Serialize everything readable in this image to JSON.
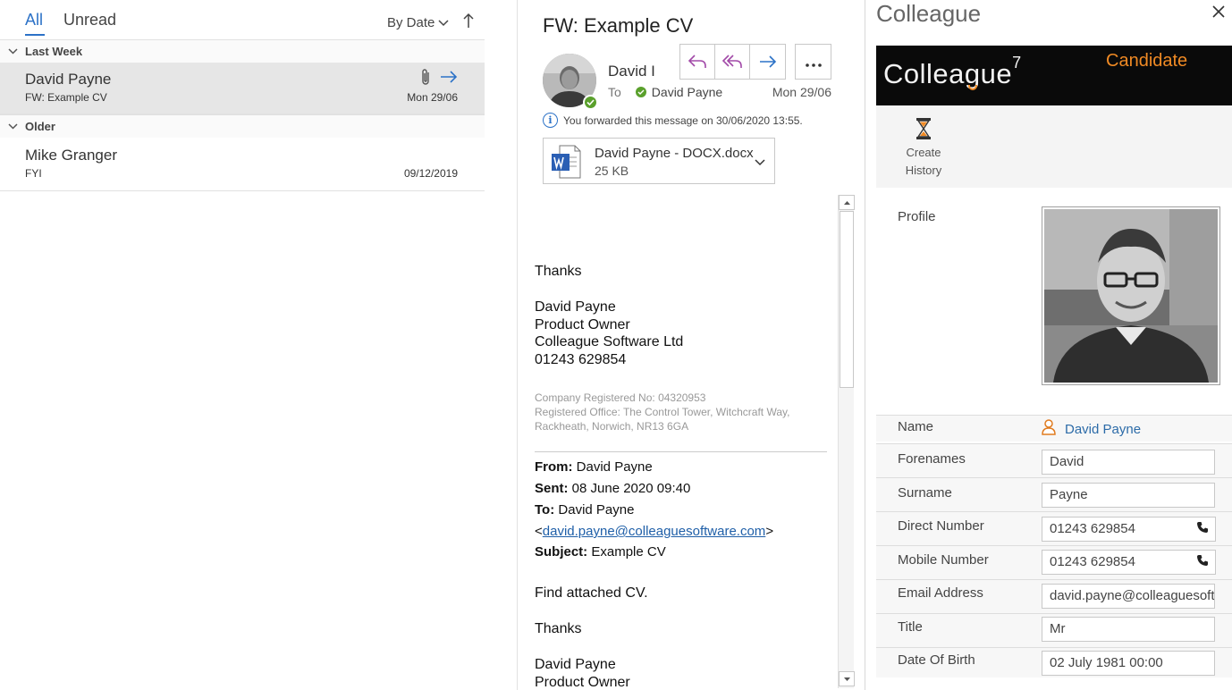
{
  "list": {
    "tabs": [
      {
        "label": "All"
      },
      {
        "label": "Unread"
      }
    ],
    "sort_label": "By Date",
    "groups": [
      {
        "label": "Last Week"
      },
      {
        "label": "Older"
      }
    ],
    "messages": [
      {
        "sender": "David Payne",
        "subject": "FW: Example CV",
        "date": "Mon 29/06"
      },
      {
        "sender": "Mike Granger",
        "subject": "FYI",
        "date": "09/12/2019"
      }
    ]
  },
  "reading": {
    "subject": "FW: Example CV",
    "sender": "David I",
    "to_label": "To",
    "recipient": "David Payne",
    "date": "Mon 29/06",
    "forward_note": "You forwarded this message on 30/06/2020 13:55.",
    "attachment": {
      "name": "David Payne - DOCX.docx",
      "size": "25 KB"
    },
    "body": {
      "thanks1": "Thanks",
      "sig_lines": [
        "David Payne",
        "Product Owner",
        "Colleague Software Ltd",
        "01243 629854"
      ],
      "disclaimer": [
        "Company Registered No: 04320953",
        "Registered Office: The Control Tower, Witchcraft Way,",
        "Rackheath, Norwich, NR13 6GA"
      ],
      "from_label": "From:",
      "from_value": "David Payne",
      "sent_label": "Sent:",
      "sent_value": "08 June 2020 09:40",
      "to_label": "To:",
      "to_value": "David Payne",
      "email_open": "<",
      "email_link": "david.payne@colleaguesoftware.com",
      "email_close": ">",
      "subject_label": "Subject:",
      "subject_value": "Example CV",
      "find_text": "Find attached CV.",
      "thanks2": "Thanks",
      "sig2_lines": [
        "David Payne",
        "Product Owner"
      ]
    }
  },
  "addin": {
    "title": "Colleague",
    "banner_logo": "Colleague",
    "banner_logo_sup": "7",
    "banner_tag": "Candidate",
    "create_history_line1": "Create",
    "create_history_line2": "History",
    "profile_label": "Profile",
    "name_label": "Name",
    "name_value": "David Payne",
    "fields": [
      {
        "label": "Forenames",
        "value": "David"
      },
      {
        "label": "Surname",
        "value": "Payne"
      },
      {
        "label": "Direct Number",
        "value": "01243 629854"
      },
      {
        "label": "Mobile Number",
        "value": "01243 629854"
      },
      {
        "label": "Email Address",
        "value": "david.payne@colleaguesoftware.com"
      },
      {
        "label": "Title",
        "value": "Mr"
      },
      {
        "label": "Date Of Birth",
        "value": "02 July 1981 00:00"
      }
    ]
  },
  "colors": {
    "accent": "#2c72c7",
    "brand_orange": "#f08a24",
    "presence": "#5aa02c"
  }
}
